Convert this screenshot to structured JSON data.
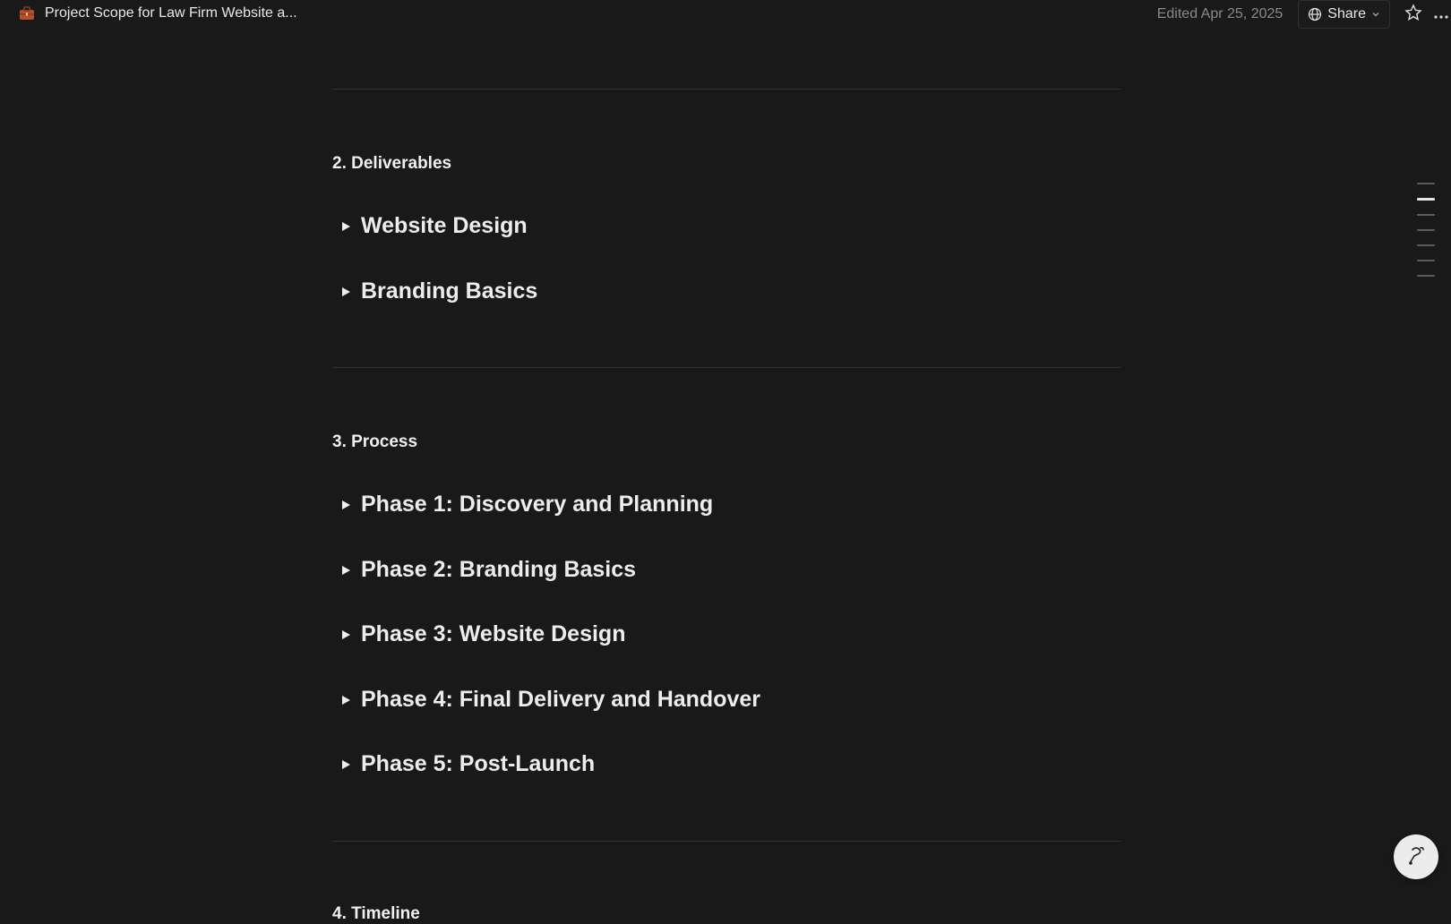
{
  "header": {
    "doc_title": "Project Scope for Law Firm Website a...",
    "doc_icon": "briefcase-icon",
    "edited": "Edited Apr 25, 2025",
    "share_label": "Share",
    "star_icon": "star-icon",
    "more_icon": "more-icon"
  },
  "sections": [
    {
      "heading": "2. Deliverables",
      "toggles": [
        "Website Design",
        "Branding Basics"
      ]
    },
    {
      "heading": "3. Process",
      "toggles": [
        "Phase 1: Discovery and Planning",
        "Phase 2: Branding Basics",
        "Phase 3: Website Design",
        "Phase 4: Final Delivery and Handover",
        "Phase 5: Post-Launch"
      ]
    }
  ],
  "next_heading_partial": "4. Timeline",
  "toc": {
    "items": 7,
    "active_index": 1
  },
  "help_icon": "help-icon"
}
